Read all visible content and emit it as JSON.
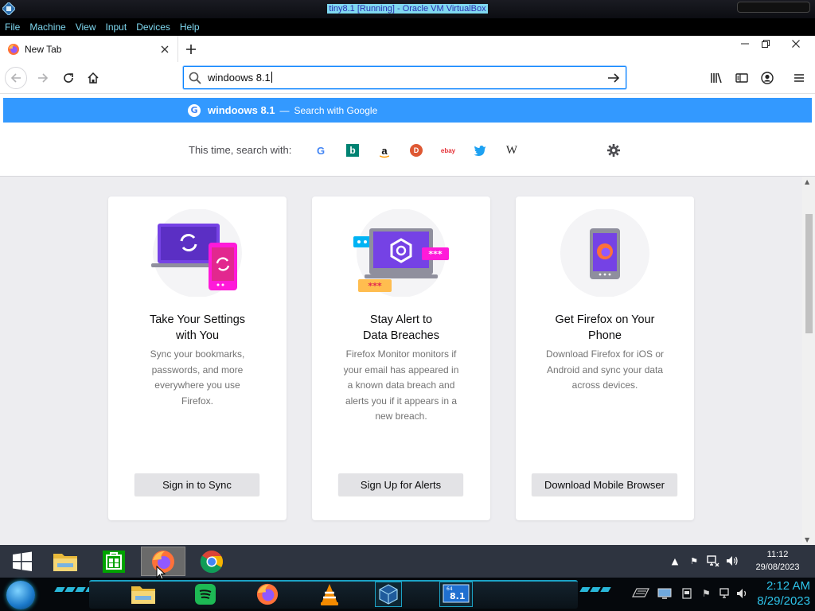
{
  "host": {
    "window_title": "tiny8.1 [Running] - Oracle VM VirtualBox",
    "menu": [
      "File",
      "Machine",
      "View",
      "Input",
      "Devices",
      "Help"
    ],
    "dock_apps": [
      "file-explorer",
      "spotify",
      "firefox",
      "vlc",
      "virtualbox",
      "windows-8.1-vm"
    ],
    "dock_vm_badge": "8.1",
    "dock_vm_badge_small": "64",
    "clock_time": "2:12 AM",
    "clock_date": "8/29/2023"
  },
  "browser": {
    "tab_title": "New Tab",
    "url_value": "windoows 8.1",
    "suggestion": {
      "query": "windoows 8.1",
      "separator": "—",
      "action": "Search with Google"
    },
    "oneoff_label": "This time, search with:",
    "engines": [
      "google",
      "bing",
      "amazon",
      "duckduckgo",
      "ebay",
      "twitter",
      "wikipedia"
    ],
    "engine_glyphs": {
      "google": "G",
      "bing": "b",
      "amazon": "a",
      "duckduckgo": "D",
      "ebay": "ebay",
      "wikipedia": "W"
    }
  },
  "cards": [
    {
      "title_line1": "Take Your Settings",
      "title_line2": "with You",
      "body": "Sync your bookmarks, passwords, and more everywhere you use Firefox.",
      "button": "Sign in to Sync"
    },
    {
      "title_line1": "Stay Alert to",
      "title_line2": "Data Breaches",
      "body": "Firefox Monitor monitors if your email has appeared in a known data breach and alerts you if it appears in a new breach.",
      "button": "Sign Up for Alerts",
      "art_text": "***"
    },
    {
      "title_line1": "Get Firefox on Your",
      "title_line2": "Phone",
      "body": "Download Firefox for iOS or Android and sync your data across devices.",
      "button": "Download Mobile Browser"
    }
  ],
  "guest_taskbar": {
    "apps": [
      "file-explorer",
      "windows-store",
      "firefox",
      "chrome"
    ],
    "active_app": "firefox",
    "clock_time": "11:12",
    "clock_date": "29/08/2023"
  },
  "colors": {
    "accent_blue": "#0a84ff",
    "suggestion_bg": "#3399ff",
    "card_art_purple": "#5b2fc4",
    "card_art_pink": "#ff1ad9",
    "host_accent": "#1ca2c4"
  }
}
